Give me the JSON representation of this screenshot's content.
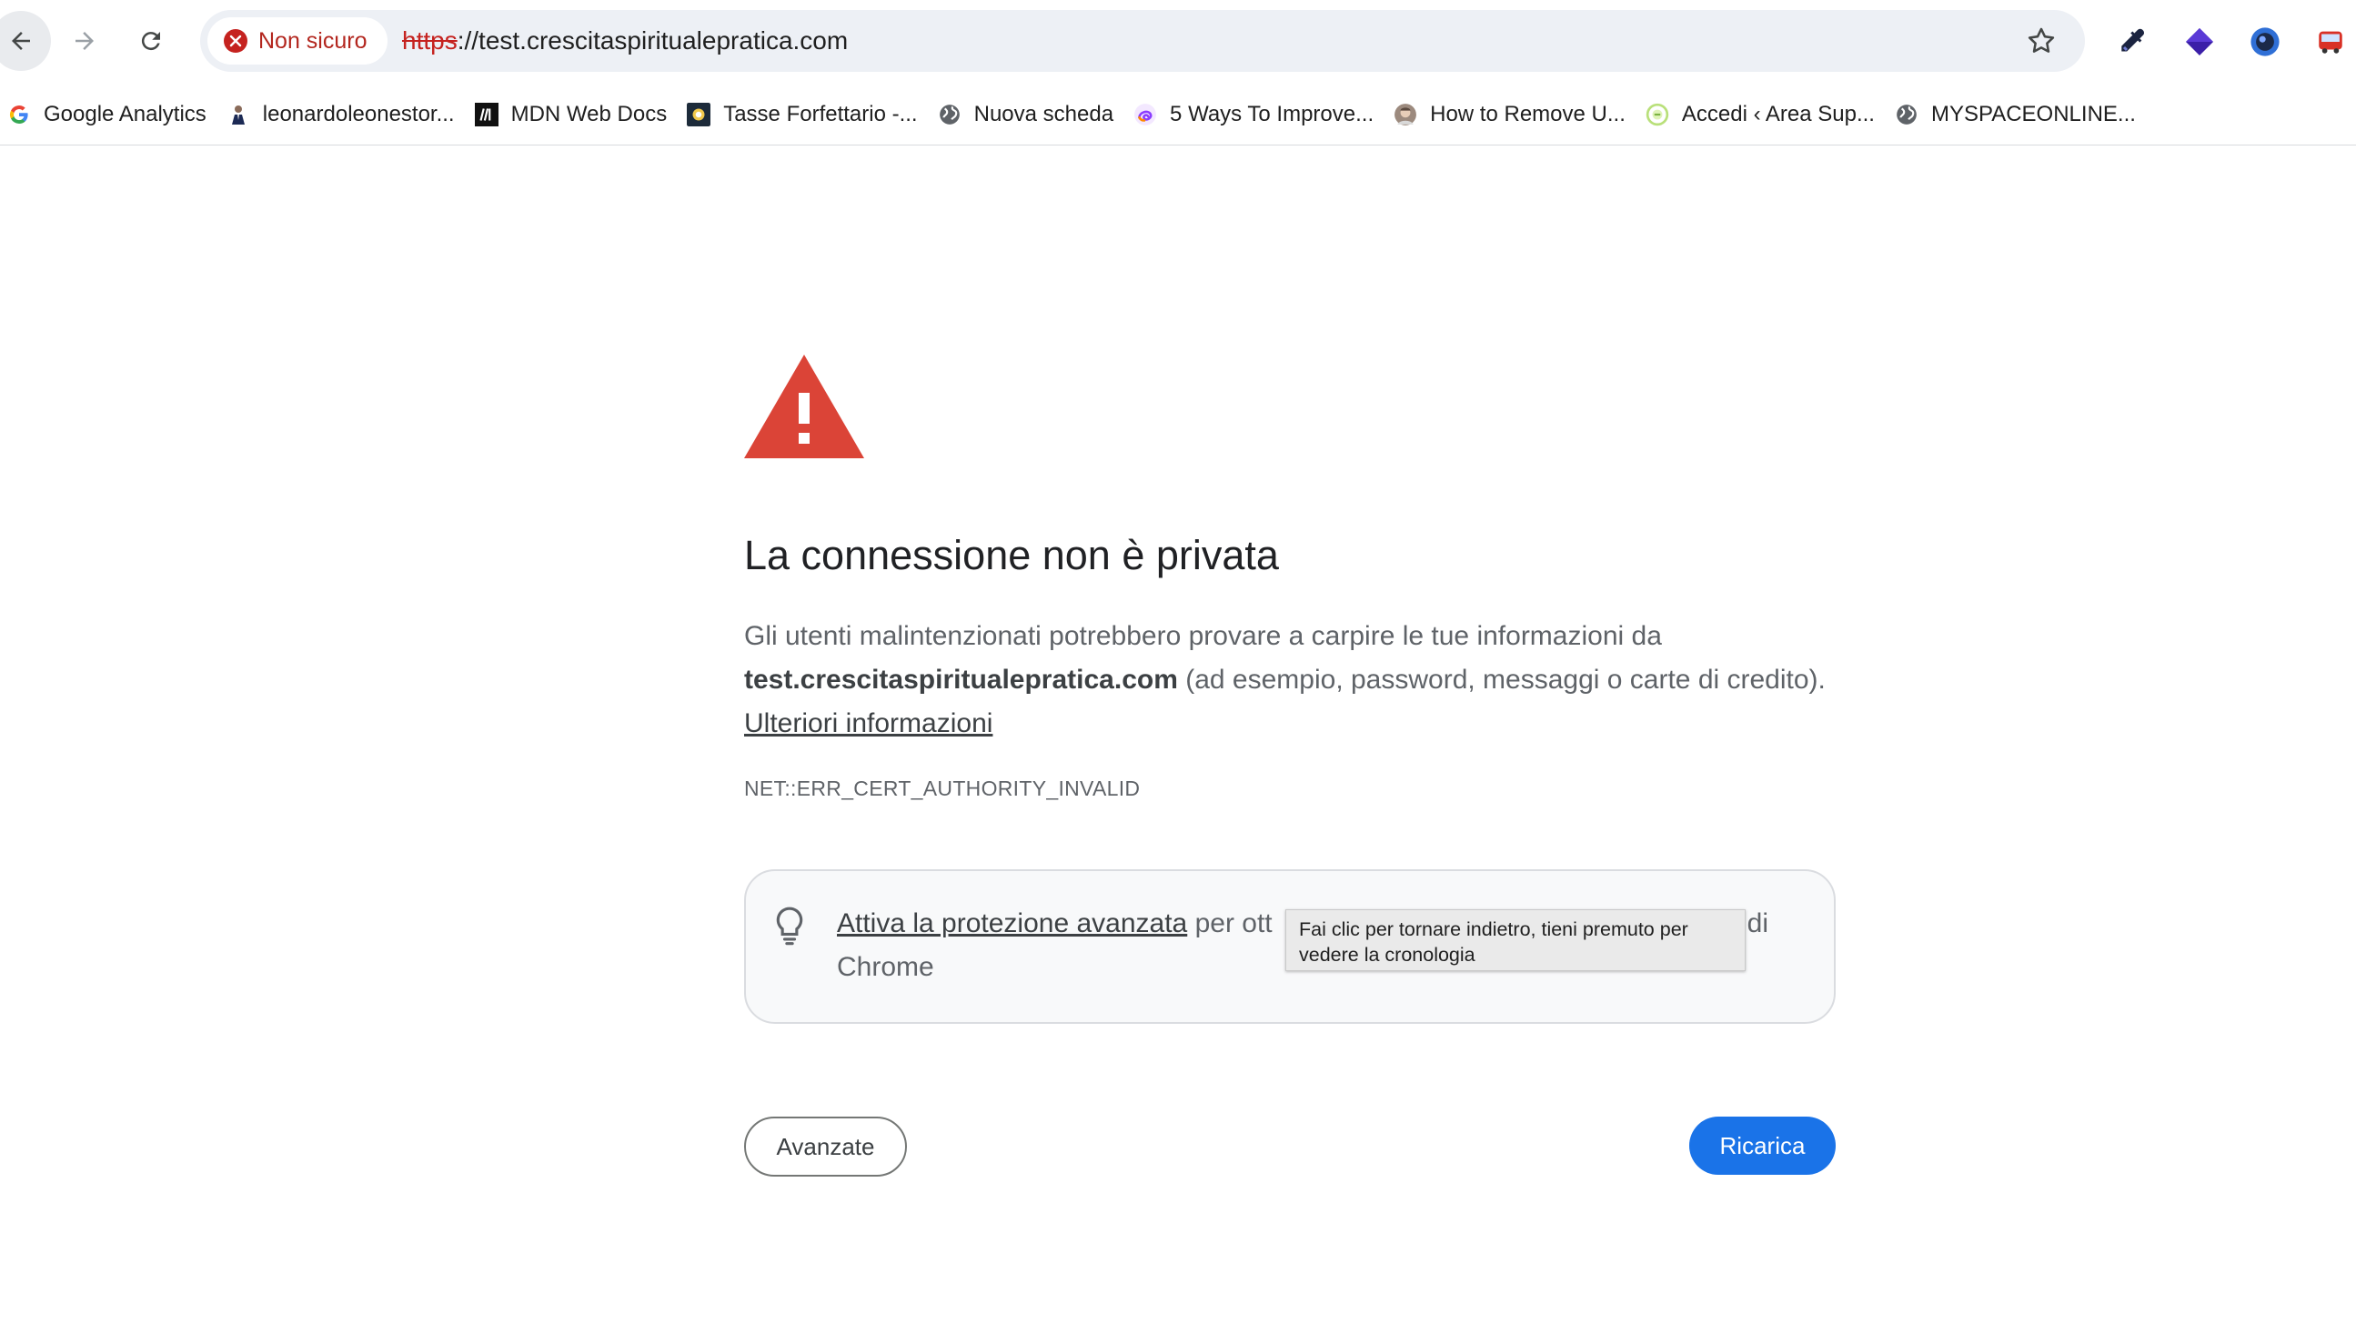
{
  "toolbar": {
    "security_label": "Non sicuro",
    "url_scheme": "https",
    "url_rest": "://test.crescitaspiritualepratica.com"
  },
  "bookmarks": [
    {
      "label": "Google Analytics",
      "icon": "google-g-icon"
    },
    {
      "label": "leonardoleonestor...",
      "icon": "person-avatar-icon"
    },
    {
      "label": "MDN Web Docs",
      "icon": "mdn-logo-icon"
    },
    {
      "label": "Tasse Forfettario -...",
      "icon": "coin-icon"
    },
    {
      "label": "Nuova scheda",
      "icon": "globe-icon"
    },
    {
      "label": "5 Ways To Improve...",
      "icon": "swirl-logo-icon"
    },
    {
      "label": "How to Remove U...",
      "icon": "person-avatar-icon"
    },
    {
      "label": "Accedi ‹ Area Sup...",
      "icon": "green-circle-icon"
    },
    {
      "label": "MYSPACEONLINE...",
      "icon": "globe-icon"
    }
  ],
  "interstitial": {
    "heading": "La connessione non è privata",
    "para_1": "Gli utenti malintenzionati potrebbero provare a carpire le tue informazioni da",
    "domain": "test.crescitaspiritualepratica.com",
    "para_2": " (ad esempio, password, messaggi o carte di credito). ",
    "learn_more": "Ulteriori informazioni",
    "error_code": "NET::ERR_CERT_AUTHORITY_INVALID",
    "promo_link": "Attiva la protezione avanzata",
    "promo_text_1": " per ott",
    "promo_text_2": "di",
    "promo_text_3": "Chrome",
    "tooltip": "Fai clic per tornare indietro, tieni premuto per vedere la cronologia",
    "advanced_button": "Avanzate",
    "reload_button": "Ricarica"
  },
  "colors": {
    "warning_red": "#db4437",
    "insecure_red": "#c5221f",
    "primary_blue": "#1a73e8"
  }
}
